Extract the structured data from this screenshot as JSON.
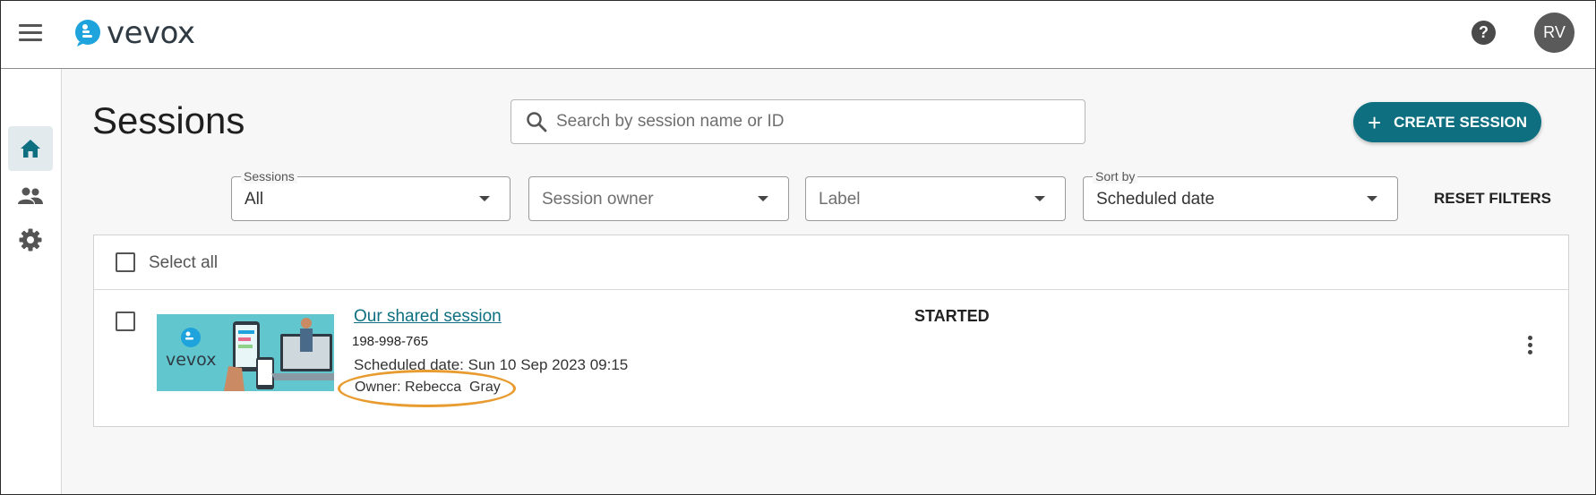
{
  "app": {
    "logo_text": "vevox",
    "avatar_initials": "RV"
  },
  "page": {
    "title": "Sessions"
  },
  "search": {
    "placeholder": "Search by session name or ID",
    "value": ""
  },
  "actions": {
    "create_label": "CREATE SESSION",
    "reset_filters_label": "RESET FILTERS"
  },
  "filters": {
    "sessions": {
      "label": "Sessions",
      "value": "All"
    },
    "owner": {
      "placeholder": "Session owner"
    },
    "label": {
      "placeholder": "Label"
    },
    "sort": {
      "label": "Sort by",
      "value": "Scheduled date"
    }
  },
  "table": {
    "select_all_label": "Select all",
    "rows": [
      {
        "name": "Our shared session",
        "id": "198-998-765",
        "scheduled": "Scheduled date: Sun 10 Sep 2023 09:15",
        "owner": "Owner: Rebecca  Gray",
        "status": "STARTED",
        "thumbnail_text": "vevox"
      }
    ]
  },
  "colors": {
    "brand": "#0e6f80",
    "logo_blue": "#1fa3dc",
    "highlight": "#e89c30"
  },
  "icons": [
    "menu-icon",
    "help-icon",
    "home-icon",
    "people-icon",
    "gear-icon",
    "search-icon",
    "plus-icon",
    "more-vertical-icon"
  ]
}
